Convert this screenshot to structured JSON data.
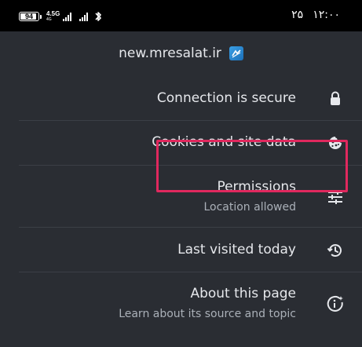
{
  "status_bar": {
    "battery": "94",
    "battery_level": 0.94,
    "network": "4.5G",
    "network_sub": "4G",
    "time": "۱۲:۰۰",
    "date": "۲۵"
  },
  "site": {
    "domain": "new.mresalat.ir",
    "favicon": "site-favicon"
  },
  "rows": [
    {
      "title": "Connection is secure",
      "icon": "lock-icon"
    },
    {
      "title": "Cookies and site data",
      "icon": "cookie-icon"
    },
    {
      "title": "Permissions",
      "subtitle": "Location allowed",
      "icon": "tune-icon"
    },
    {
      "title": "Last visited today",
      "icon": "history-icon"
    },
    {
      "title": "About this page",
      "subtitle": "Learn about its source and topic",
      "icon": "info-sparkle-icon"
    }
  ],
  "colors": {
    "panel_bg": "#2a2d33",
    "text_primary": "#e6e8ec",
    "text_secondary": "#aab0b8",
    "highlight": "#e0285e"
  }
}
